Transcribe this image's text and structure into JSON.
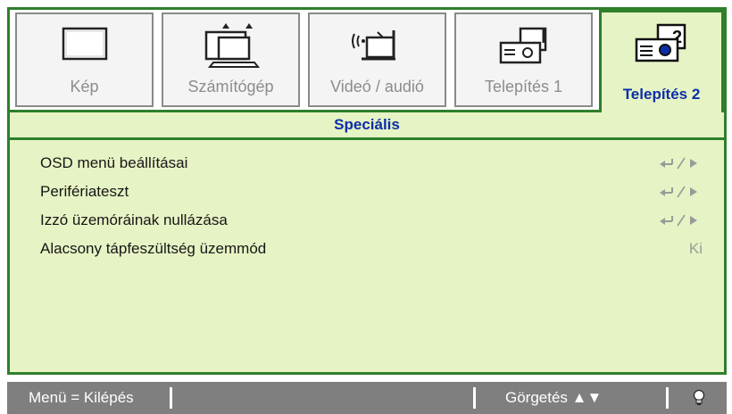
{
  "tabs": [
    {
      "label": "Kép",
      "icon": "screen-icon",
      "active": false
    },
    {
      "label": "Számítógép",
      "icon": "computer-icon",
      "active": false
    },
    {
      "label": "Videó / audió",
      "icon": "video-audio-icon",
      "active": false
    },
    {
      "label": "Telepítés 1",
      "icon": "projector-setup-icon",
      "active": false
    },
    {
      "label": "Telepítés 2",
      "icon": "projector-advanced-icon",
      "active": true
    }
  ],
  "section": {
    "title": "Speciális"
  },
  "items": [
    {
      "label": "OSD menü beállításai",
      "value": "",
      "icon": "enter-arrow-icon"
    },
    {
      "label": "Perifériateszt",
      "value": "",
      "icon": "enter-arrow-icon"
    },
    {
      "label": "Izzó üzemóráinak nullázása",
      "value": "",
      "icon": "enter-arrow-icon"
    },
    {
      "label": "Alacsony tápfeszültség üzemmód",
      "value": "Ki",
      "icon": ""
    }
  ],
  "statusbar": {
    "exit_text": "Menü = Kilépés",
    "scroll_text": "Görgetés ▲▼",
    "lamp_icon": "lamp-icon"
  },
  "colors": {
    "accent_green": "#2f7f2b",
    "panel_green": "#e6f3c4",
    "active_blue": "#0b2ea8",
    "status_gray": "#7f7f7f"
  }
}
